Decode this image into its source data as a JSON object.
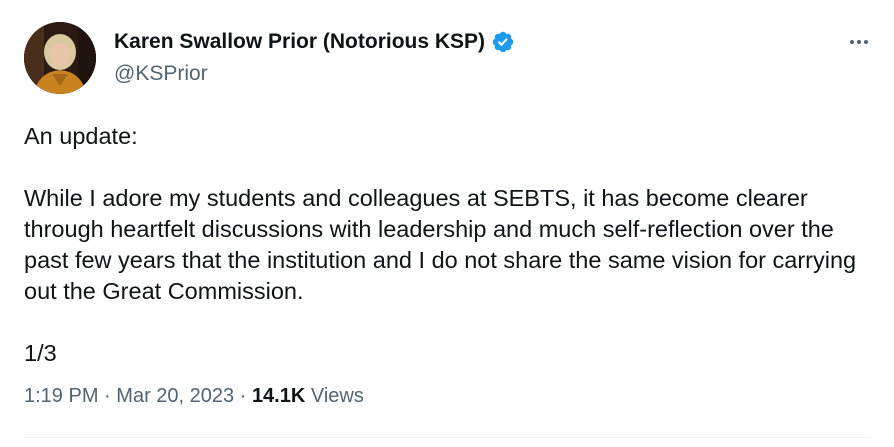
{
  "author": {
    "display_name": "Karen Swallow Prior (Notorious KSP)",
    "handle": "@KSPrior",
    "verified": true,
    "avatar_icon": "profile-photo"
  },
  "more_icon": "more-dots-icon",
  "tweet": {
    "text": "An update:\n\nWhile I adore my students and colleagues at SEBTS, it has become clearer through heartfelt discussions with leadership and much self-reflection over the past few years that the institution and I do not share the same vision for carrying out the Great Commission.\n\n1/3"
  },
  "meta": {
    "time": "1:19 PM",
    "separator": "·",
    "date": "Mar 20, 2023",
    "views_count": "14.1K",
    "views_label": "Views"
  },
  "colors": {
    "text": "#0f1419",
    "secondary": "#536471",
    "verified": "#1d9bf0",
    "divider": "#eff3f4"
  }
}
